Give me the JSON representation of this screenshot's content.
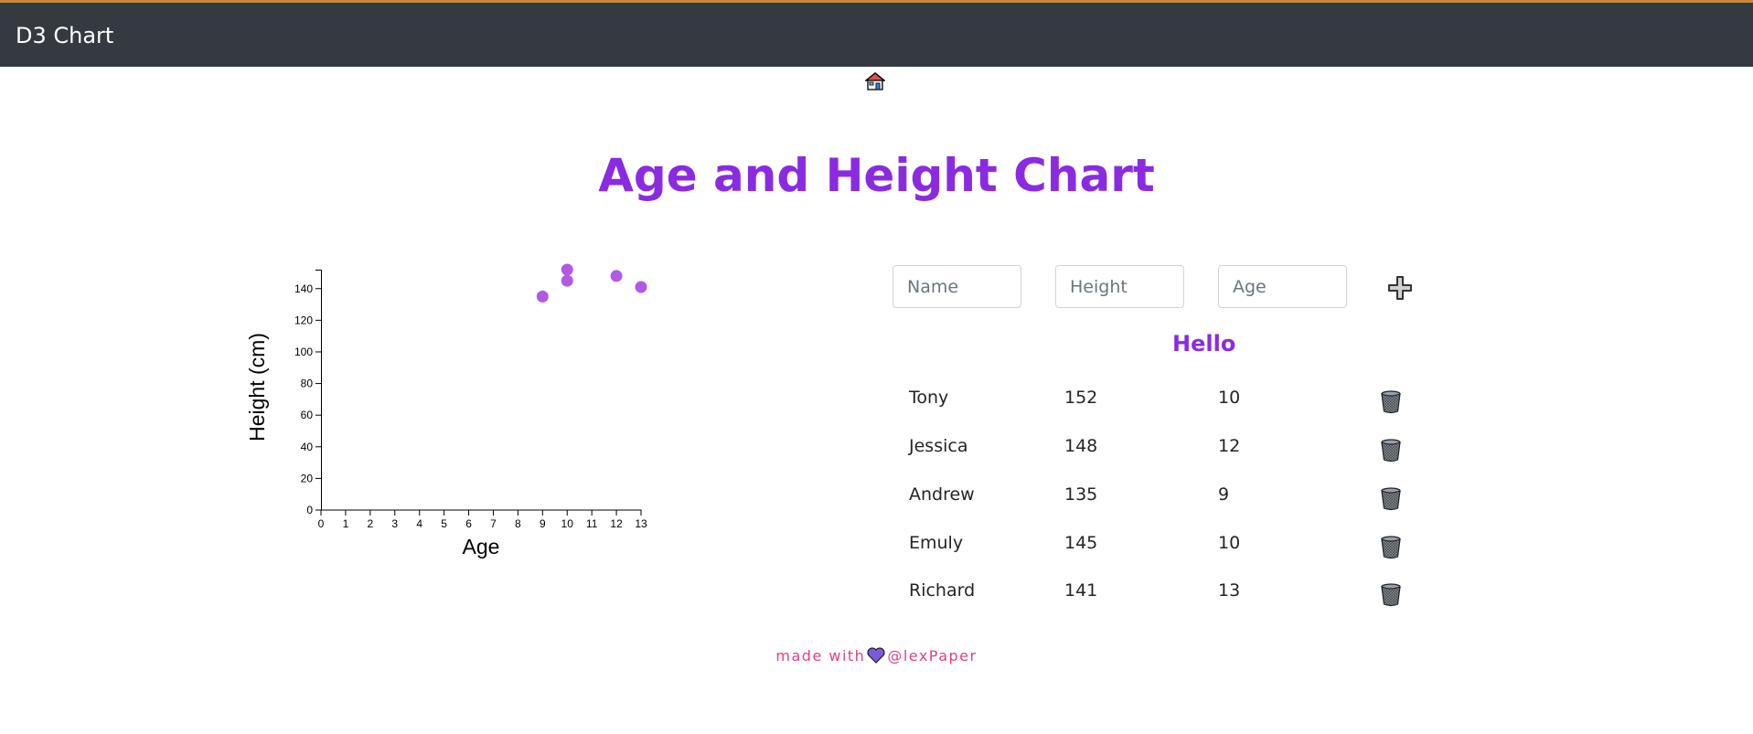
{
  "navbar": {
    "brand": "D3 Chart"
  },
  "home": {
    "icon": "house-icon"
  },
  "page": {
    "title": "Age and Height Chart"
  },
  "form": {
    "name_placeholder": "Name",
    "height_placeholder": "Height",
    "age_placeholder": "Age",
    "add_icon": "plus-icon"
  },
  "hello": "Hello",
  "rows": [
    {
      "name": "Tony",
      "height": "152",
      "age": "10"
    },
    {
      "name": "Jessica",
      "height": "148",
      "age": "12"
    },
    {
      "name": "Andrew",
      "height": "135",
      "age": "9"
    },
    {
      "name": "Emuly",
      "height": "145",
      "age": "10"
    },
    {
      "name": "Richard",
      "height": "141",
      "age": "13"
    }
  ],
  "footer": {
    "made_with": "made with",
    "handle": "@lexPaper",
    "heart_icon": "heart-icon"
  },
  "colors": {
    "accent": "#8a2be2",
    "point": "#b05ae6",
    "navbar": "#343a40",
    "footer": "#e0408a"
  },
  "chart_data": {
    "type": "scatter",
    "xlabel": "Age",
    "ylabel": "Height (cm)",
    "x_ticks": [
      0,
      1,
      2,
      3,
      4,
      5,
      6,
      7,
      8,
      9,
      10,
      11,
      12,
      13
    ],
    "y_ticks": [
      0,
      20,
      40,
      60,
      80,
      100,
      120,
      140
    ],
    "xlim": [
      0,
      13
    ],
    "ylim": [
      0,
      152
    ],
    "points": [
      {
        "x": 9,
        "y": 135
      },
      {
        "x": 10,
        "y": 152
      },
      {
        "x": 10,
        "y": 145
      },
      {
        "x": 12,
        "y": 148
      },
      {
        "x": 13,
        "y": 141
      }
    ]
  }
}
